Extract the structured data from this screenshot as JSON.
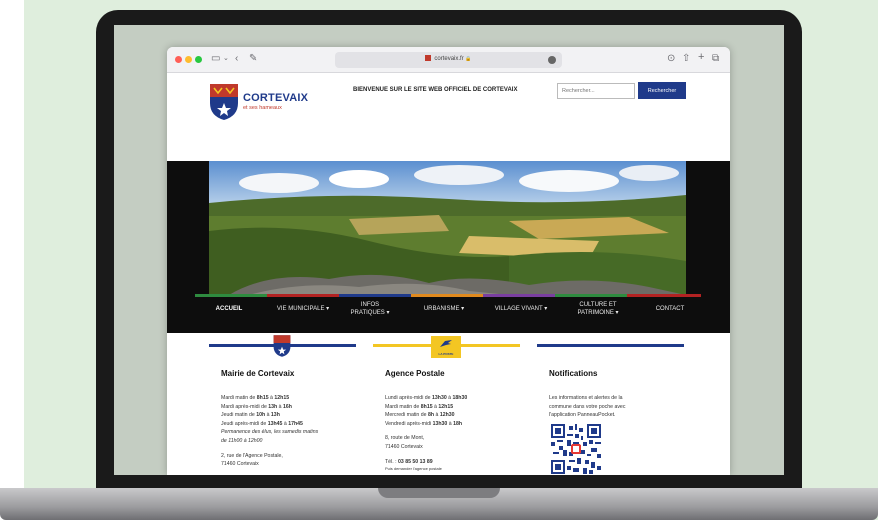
{
  "browser": {
    "url": "cortevaix.fr"
  },
  "site": {
    "logo_title": "CORTEVAIX",
    "logo_subtitle": "et ses hameaux",
    "welcome": "BIENVENUE SUR LE SITE WEB OFFICIEL DE CORTEVAIX",
    "search_placeholder": "Rechercher...",
    "search_button": "Rechercher"
  },
  "nav": {
    "items": [
      {
        "label": "ACCUEIL",
        "color": "#2e8b3f"
      },
      {
        "label": "VIE MUNICIPALE ▾",
        "color": "#b22222"
      },
      {
        "label": "INFOS PRATIQUES ▾",
        "color": "#1f3a8a"
      },
      {
        "label": "URBANISME ▾",
        "color": "#e08a1e"
      },
      {
        "label": "VILLAGE VIVANT ▾",
        "color": "#7a3fa0"
      },
      {
        "label": "CULTURE ET PATRIMOINE ▾",
        "color": "#2e8b3f"
      },
      {
        "label": "CONTACT",
        "color": "#b22222"
      }
    ]
  },
  "cards": {
    "mairie": {
      "title": "Mairie de Cortevaix",
      "accent": "#1f3a8a",
      "line1_pre": "Mardi matin de ",
      "line1_b1": "8h15",
      "line1_mid": " à ",
      "line1_b2": "12h15",
      "line2_pre": "Mardi après-midi de ",
      "line2_b1": "13h",
      "line2_mid": " à ",
      "line2_b2": "16h",
      "line3_pre": "Jeudi matin de ",
      "line3_b1": "10h",
      "line3_mid": " à ",
      "line3_b2": "13h",
      "line4_pre": "Jeudi après-midi de ",
      "line4_b1": "13h45",
      "line4_mid": " à ",
      "line4_b2": "17h45",
      "line5": "Permanence des élus, les samedis matins",
      "line6": "de 11h00 à 12h00",
      "address1": "2, rue de l'Agence Postale,",
      "address2": "71460 Cortevaix"
    },
    "agence": {
      "title": "Agence Postale",
      "accent": "#f3c623",
      "logo_text": "LA POSTE",
      "line1_pre": "Lundi après-midi de ",
      "line1_b1": "13h30",
      "line1_mid": " à ",
      "line1_b2": "18h30",
      "line2_pre": "Mardi matin de ",
      "line2_b1": "8h15",
      "line2_mid": " à ",
      "line2_b2": "12h15",
      "line3_pre": "Mercredi matin de ",
      "line3_b1": "8h",
      "line3_mid": " à ",
      "line3_b2": "12h30",
      "line4_pre": "Vendredi après-midi ",
      "line4_b1": "13h30",
      "line4_mid": " à ",
      "line4_b2": "18h",
      "address1": "8, route de Mont,",
      "address2": "71460 Cortevaix",
      "phone_pre": "Tél. : ",
      "phone": "03 85 50 13 89",
      "phone_note": "Puis demander l'agence postale"
    },
    "notifications": {
      "title": "Notifications",
      "accent": "#1f3a8a",
      "line1": "Les informations et alertes de la",
      "line2": "commune dans votre poche avec",
      "line3": "l'application PanneauPocket."
    }
  }
}
